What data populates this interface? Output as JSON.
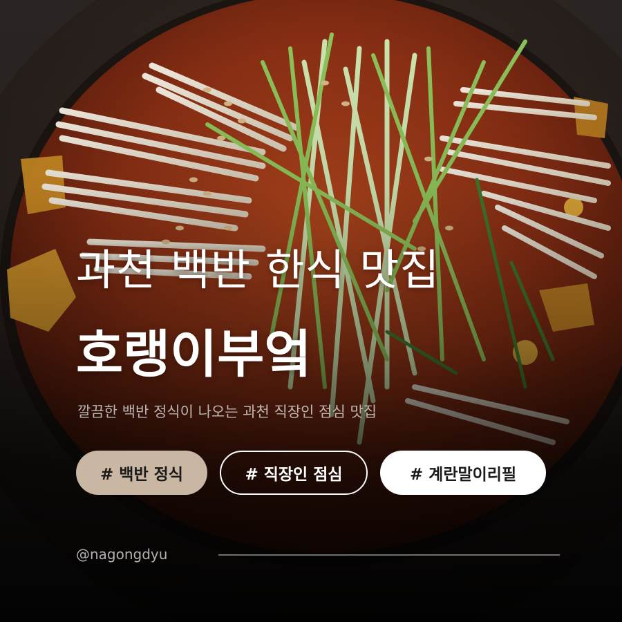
{
  "title_line1": "과천 백반 한식 맛집",
  "title_line2": "호랭이부엌",
  "subtitle": "깔끔한 백반 정식이 나오는 과천 직장인 점심 맛집",
  "tags": [
    {
      "label": "# 백반 정식"
    },
    {
      "label": "# 직장인 점심"
    },
    {
      "label": "# 계란말이리필"
    }
  ],
  "handle": "@nagongdyu",
  "colors": {
    "tag1_bg": "#c9b6a3",
    "tag3_bg": "#ffffff",
    "broth": "#8a2f14",
    "pot": "#231c18",
    "text": "#ffffff"
  },
  "background_image": "stew-photo"
}
